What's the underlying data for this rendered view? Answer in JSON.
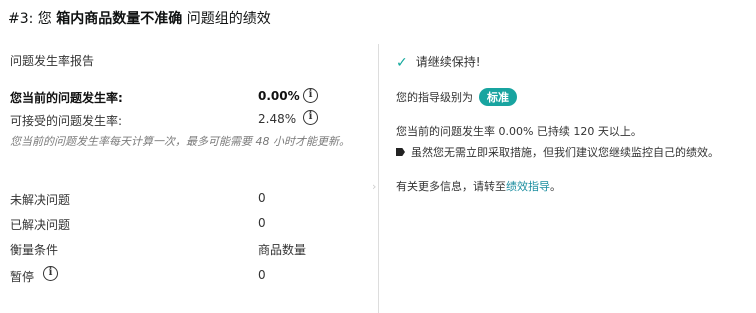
{
  "header": {
    "prefix": "#3: 您 ",
    "bold": "箱内商品数量不准确",
    "suffix": " 问题组的绩效"
  },
  "report": {
    "section_title": "问题发生率报告",
    "current_rate_label": "您当前的问题发生率:",
    "current_rate_value": "0.00%",
    "acceptable_rate_label": "可接受的问题发生率:",
    "acceptable_rate_value": "2.48%",
    "note": "您当前的问题发生率每天计算一次，最多可能需要 48 小时才能更新。",
    "rows": [
      {
        "label": "未解决问题",
        "value": "0"
      },
      {
        "label": "已解决问题",
        "value": "0"
      },
      {
        "label": "衡量条件",
        "value": "商品数量"
      },
      {
        "label": "暂停",
        "value": "0"
      }
    ]
  },
  "guidance": {
    "status": "请继续保持!",
    "level_label": "您的指导级别为",
    "level_badge": "标准",
    "stat_text": "您当前的问题发生率 0.00% 已持续 120 天以上。",
    "tip_text": "虽然您无需立即采取措施，但我们建议您继续监控自己的绩效。",
    "more_prefix": "有关更多信息，请转至",
    "more_link": "绩效指导",
    "more_suffix": "。"
  }
}
